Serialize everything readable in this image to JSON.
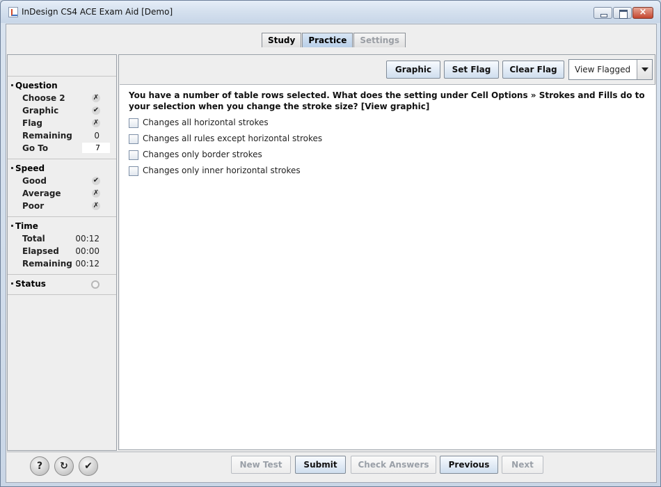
{
  "window": {
    "title": "InDesign CS4 ACE Exam Aid [Demo]"
  },
  "tabs": [
    {
      "label": "Study"
    },
    {
      "label": "Practice"
    },
    {
      "label": "Settings"
    }
  ],
  "sidebar": {
    "question": {
      "heading": "Question",
      "rows": [
        {
          "label": "Choose 2",
          "icon": "cross-icon"
        },
        {
          "label": "Graphic",
          "icon": "check-icon"
        },
        {
          "label": "Flag",
          "icon": "cross-icon"
        },
        {
          "label": "Remaining",
          "value": "0"
        },
        {
          "label": "Go To",
          "value": "7"
        }
      ]
    },
    "speed": {
      "heading": "Speed",
      "rows": [
        {
          "label": "Good",
          "icon": "check-icon"
        },
        {
          "label": "Average",
          "icon": "cross-icon"
        },
        {
          "label": "Poor",
          "icon": "cross-icon"
        }
      ]
    },
    "time": {
      "heading": "Time",
      "rows": [
        {
          "label": "Total",
          "value": "00:12"
        },
        {
          "label": "Elapsed",
          "value": "00:00"
        },
        {
          "label": "Remaining",
          "value": "00:12"
        }
      ]
    },
    "status": {
      "heading": "Status"
    }
  },
  "toolbar": {
    "graphic": "Graphic",
    "set_flag": "Set Flag",
    "clear_flag": "Clear Flag",
    "view_select": "View Flagged"
  },
  "question_text": "You have a number of table rows selected. What does the setting under Cell Options » Strokes and Fills do to your selection when you change the stroke size? [View graphic]",
  "options": [
    "Changes all horizontal strokes",
    "Changes all rules except horizontal strokes",
    "Changes only border strokes",
    "Changes only inner horizontal strokes"
  ],
  "bottom": {
    "icons": [
      "help-icon",
      "history-icon",
      "checklist-icon"
    ],
    "new_test": "New Test",
    "submit": "Submit",
    "check_answers": "Check Answers",
    "previous": "Previous",
    "next": "Next"
  }
}
